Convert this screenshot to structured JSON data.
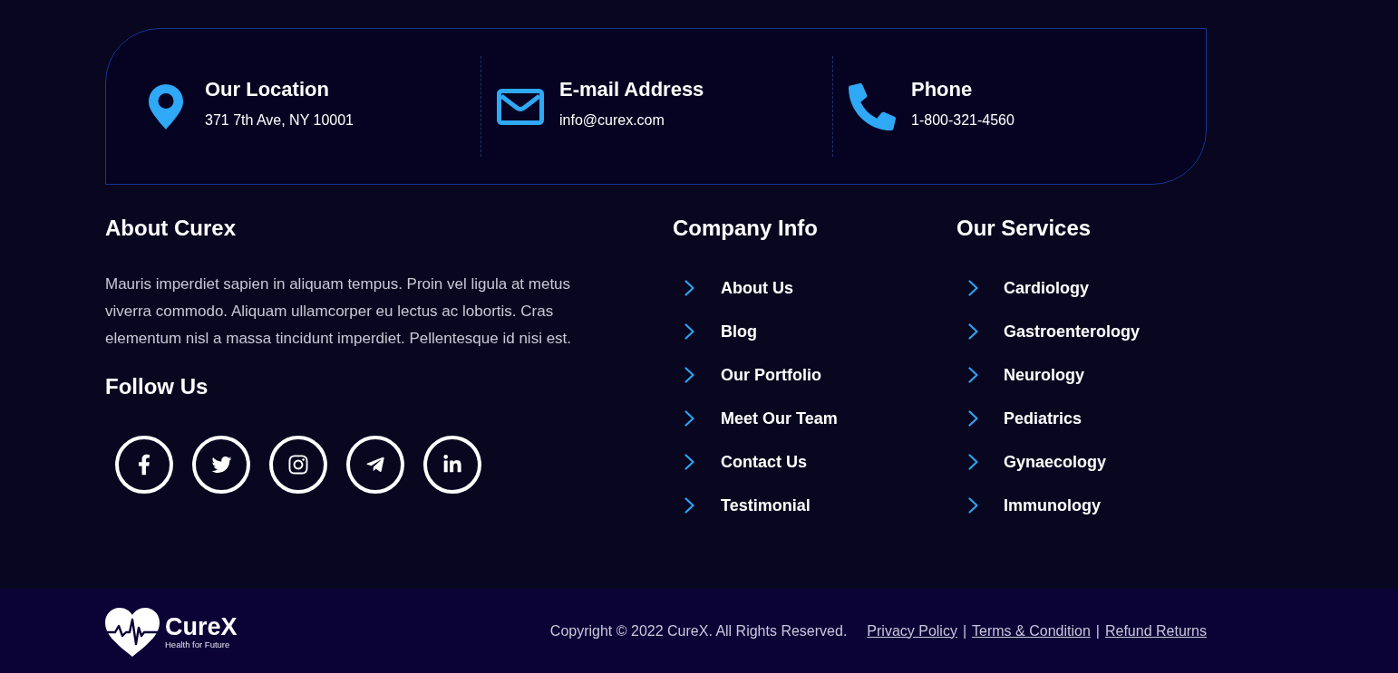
{
  "contact_card": {
    "items": [
      {
        "kind": "location",
        "title": "Our Location",
        "value": "371 7th Ave, NY 10001"
      },
      {
        "kind": "email",
        "title": "E-mail Address",
        "value": "info@curex.com"
      },
      {
        "kind": "phone",
        "title": "Phone",
        "value": "1-800-321-4560"
      }
    ]
  },
  "about": {
    "title": "About Curex",
    "text": "Mauris imperdiet sapien in aliquam tempus. Proin vel ligula at metus viverra commodo. Aliquam ullamcorper eu lectus ac lobortis. Cras elementum nisl a massa tincidunt imperdiet. Pellentesque id nisi est."
  },
  "follow": {
    "title": "Follow Us",
    "socials": [
      {
        "kind": "facebook"
      },
      {
        "kind": "twitter"
      },
      {
        "kind": "instagram"
      },
      {
        "kind": "telegram"
      },
      {
        "kind": "linkedin"
      }
    ]
  },
  "company_info": {
    "title": "Company Info",
    "links": [
      "About Us",
      "Blog",
      "Our Portfolio",
      "Meet Our Team",
      "Contact Us",
      "Testimonial"
    ]
  },
  "services": {
    "title": "Our Services",
    "links": [
      "Cardiology",
      "Gastroenterology",
      "Neurology",
      "Pediatrics",
      "Gynaecology",
      "Immunology"
    ]
  },
  "bottom_bar": {
    "logo": {
      "name": "CureX",
      "tagline": "Health for Future"
    },
    "copyright": "Copyright © 2022 CureX. All Rights Reserved.",
    "links": [
      "Privacy Policy",
      "Terms & Condition",
      "Refund Returns"
    ],
    "separators": [
      "|",
      "|"
    ]
  }
}
